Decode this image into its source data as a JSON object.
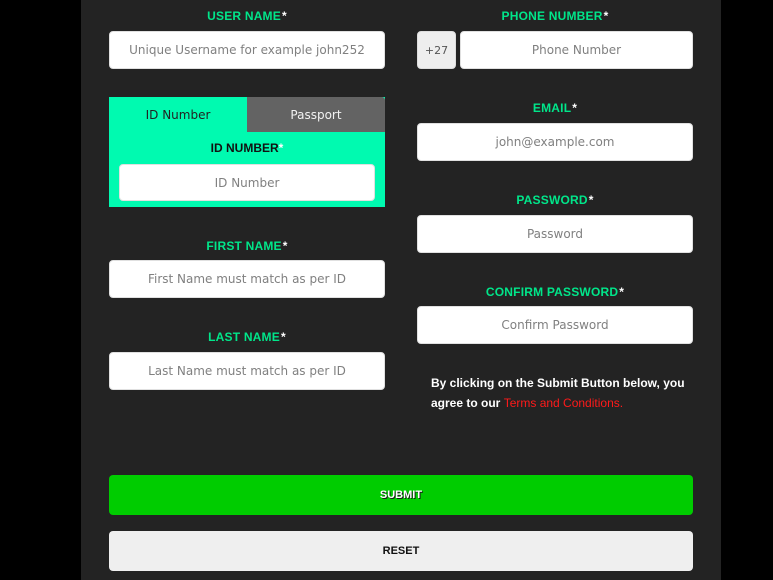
{
  "form": {
    "username": {
      "label": "USER NAME",
      "required_mark": "*",
      "placeholder": "Unique Username for example john252",
      "value": ""
    },
    "phone": {
      "label": "PHONE NUMBER",
      "required_mark": "*",
      "prefix": "+27",
      "placeholder": "Phone Number",
      "value": ""
    },
    "id_tabs": {
      "tabs": [
        {
          "label": "ID Number",
          "active": true
        },
        {
          "label": "Passport",
          "active": false
        }
      ],
      "id_number": {
        "label": "ID NUMBER",
        "required_mark": "*",
        "placeholder": "ID Number",
        "value": ""
      }
    },
    "email": {
      "label": "EMAIL",
      "required_mark": "*",
      "placeholder": "john@example.com",
      "value": ""
    },
    "password": {
      "label": "PASSWORD",
      "required_mark": "*",
      "placeholder": "Password",
      "value": ""
    },
    "first_name": {
      "label": "FIRST NAME",
      "required_mark": "*",
      "placeholder": "First Name must match as per ID",
      "value": ""
    },
    "confirm_password": {
      "label": "CONFIRM PASSWORD",
      "required_mark": "*",
      "placeholder": "Confirm Password",
      "value": ""
    },
    "last_name": {
      "label": "LAST NAME",
      "required_mark": "*",
      "placeholder": "Last Name must match as per ID",
      "value": ""
    },
    "terms": {
      "text": "By clicking on the Submit Button below, you agree to our ",
      "link_label": "Terms and Conditions."
    },
    "submit_label": "SUBMIT",
    "reset_label": "RESET"
  },
  "colors": {
    "accent": "#00fab0",
    "label": "#00e68a",
    "submit": "#00cc00",
    "link": "#ff1a1a",
    "panel": "#232323"
  }
}
